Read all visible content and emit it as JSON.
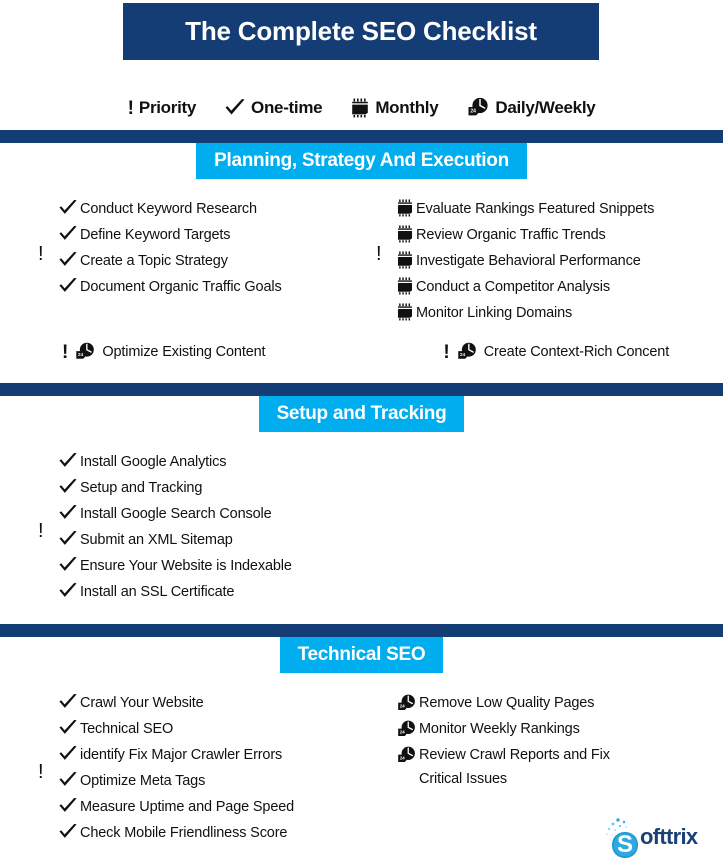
{
  "header": {
    "title": "The Complete SEO Checklist",
    "title_bg": "#153d75",
    "legend": [
      {
        "icon": "exclamation-icon",
        "label": "Priority"
      },
      {
        "icon": "check-icon",
        "label": "One-time"
      },
      {
        "icon": "calendar-icon",
        "label": "Monthly"
      },
      {
        "icon": "clock-24-icon",
        "label": "Daily/Weekly"
      }
    ]
  },
  "colors": {
    "navy": "#153d75",
    "cyan": "#00adee",
    "text": "#111111",
    "logo_blue": "#1b3f77"
  },
  "sections": [
    {
      "heading": "Planning, Strategy And Execution",
      "left_items": [
        {
          "icon": "check-icon",
          "label": "Conduct Keyword Research"
        },
        {
          "icon": "check-icon",
          "label": "Define Keyword Targets"
        },
        {
          "icon": "check-icon",
          "label": "Create a Topic Strategy"
        },
        {
          "icon": "check-icon",
          "label": "Document Organic Traffic Goals"
        }
      ],
      "left_priority": "!",
      "right_items": [
        {
          "icon": "calendar-icon",
          "label": "Evaluate Rankings Featured Snippets"
        },
        {
          "icon": "calendar-icon",
          "label": "Review Organic Traffic Trends"
        },
        {
          "icon": "calendar-icon",
          "label": "Investigate Behavioral Performance"
        },
        {
          "icon": "calendar-icon",
          "label": "Conduct a Competitor Analysis"
        },
        {
          "icon": "calendar-icon",
          "label": "Monitor Linking Domains"
        }
      ],
      "right_priority": "!",
      "pair_row": [
        {
          "priority": "!",
          "icon": "clock-24-icon",
          "label": "Optimize Existing Content"
        },
        {
          "priority": "!",
          "icon": "clock-24-icon",
          "label": "Create Context-Rich Concent"
        }
      ]
    },
    {
      "heading": "Setup and Tracking",
      "left_items": [
        {
          "icon": "check-icon",
          "label": "Install Google Analytics"
        },
        {
          "icon": "check-icon",
          "label": "Setup and Tracking"
        },
        {
          "icon": "check-icon",
          "label": "Install Google Search Console"
        },
        {
          "icon": "check-icon",
          "label": "Submit an XML Sitemap"
        },
        {
          "icon": "check-icon",
          "label": "Ensure Your Website is Indexable"
        },
        {
          "icon": "check-icon",
          "label": "Install an SSL Certificate"
        }
      ],
      "left_priority": "!",
      "right_items": []
    },
    {
      "heading": "Technical SEO",
      "left_items": [
        {
          "icon": "check-icon",
          "label": "Crawl Your Website"
        },
        {
          "icon": "check-icon",
          "label": "Technical SEO"
        },
        {
          "icon": "check-icon",
          "label": "identify Fix Major Crawler Errors"
        },
        {
          "icon": "check-icon",
          "label": "Optimize Meta Tags"
        },
        {
          "icon": "check-icon",
          "label": "Measure Uptime and Page Speed"
        },
        {
          "icon": "check-icon",
          "label": "Check Mobile Friendliness Score"
        }
      ],
      "left_priority": "!",
      "right_items": [
        {
          "icon": "clock-24-icon",
          "label": "Remove Low Quality Pages"
        },
        {
          "icon": "clock-24-icon",
          "label": "Monitor Weekly Rankings"
        },
        {
          "icon": "clock-24-icon",
          "label": "Review Crawl Reports and Fix Critical Issues"
        }
      ]
    }
  ],
  "logo": {
    "icon": "softtrix-s-icon",
    "word": "ofttrix",
    "trademark": "™"
  }
}
